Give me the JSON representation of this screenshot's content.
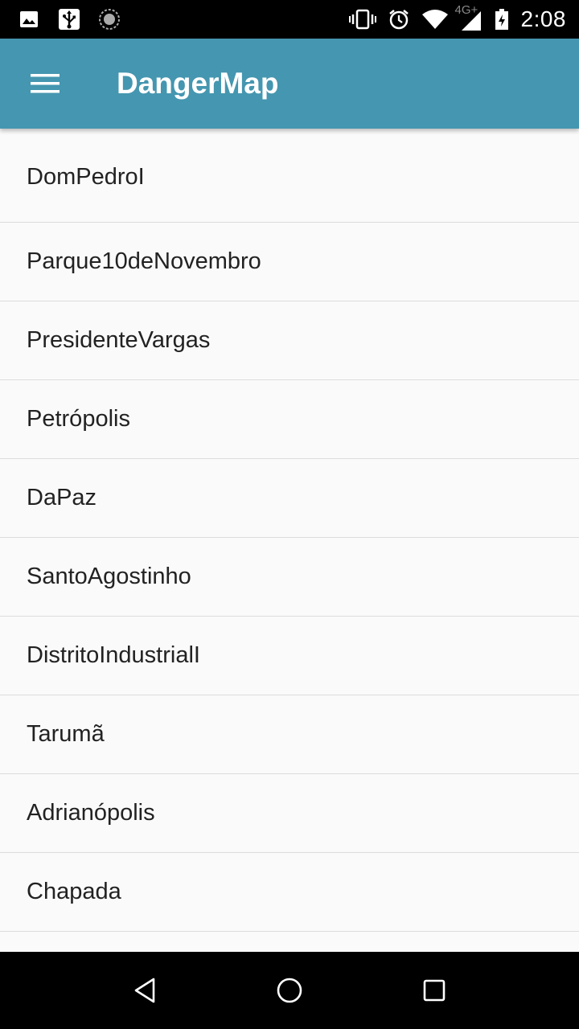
{
  "status_bar": {
    "left_icons": [
      "image-icon",
      "usb-icon",
      "sync-icon"
    ],
    "right_icons": [
      "vibrate-icon",
      "alarm-icon",
      "wifi-icon",
      "signal-icon",
      "battery-icon"
    ],
    "network_type": "4G+",
    "time": "2:08"
  },
  "app_bar": {
    "title": "DangerMap",
    "background": "#4596b0"
  },
  "neighborhoods": [
    "DomPedroI",
    "Parque10deNovembro",
    "PresidenteVargas",
    "Petrópolis",
    "DaPaz",
    "SantoAgostinho",
    "DistritoIndustrialI",
    "Tarumã",
    "Adrianópolis",
    "Chapada"
  ],
  "nav_bar": {
    "buttons": [
      "back-icon",
      "home-icon",
      "recents-icon"
    ]
  }
}
